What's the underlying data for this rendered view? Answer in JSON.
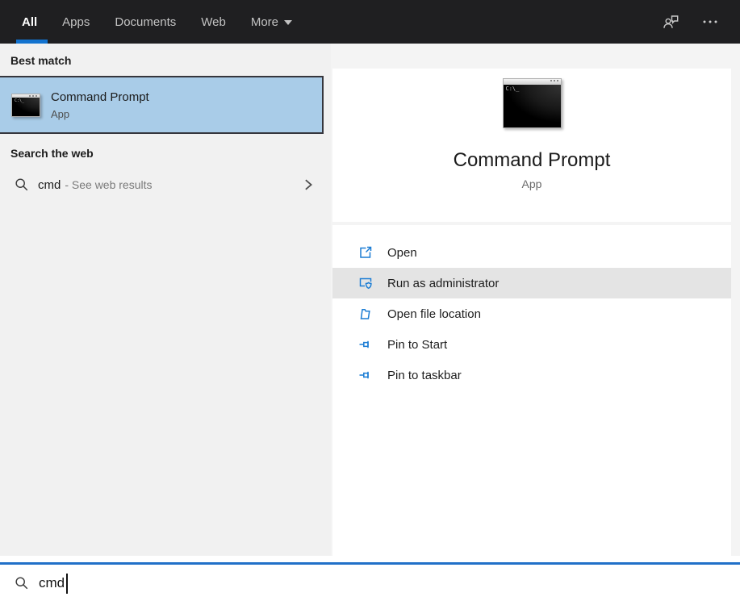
{
  "header": {
    "tabs": [
      {
        "label": "All",
        "active": true
      },
      {
        "label": "Apps",
        "active": false
      },
      {
        "label": "Documents",
        "active": false
      },
      {
        "label": "Web",
        "active": false
      },
      {
        "label": "More",
        "active": false,
        "has_dropdown": true
      }
    ]
  },
  "left_panel": {
    "best_match_header": "Best match",
    "best_match": {
      "title": "Command Prompt",
      "subtitle": "App"
    },
    "search_web_header": "Search the web",
    "web_result": {
      "query": "cmd",
      "suffix": "- See web results"
    }
  },
  "right_panel": {
    "preview": {
      "title": "Command Prompt",
      "subtitle": "App",
      "icon_prompt": "C:\\_"
    },
    "actions": [
      {
        "label": "Open",
        "icon": "launch-icon",
        "highlighted": false
      },
      {
        "label": "Run as administrator",
        "icon": "admin-shield-icon",
        "highlighted": true
      },
      {
        "label": "Open file location",
        "icon": "folder-icon",
        "highlighted": false
      },
      {
        "label": "Pin to Start",
        "icon": "pin-icon",
        "highlighted": false
      },
      {
        "label": "Pin to taskbar",
        "icon": "pin-icon",
        "highlighted": false
      }
    ]
  },
  "search_bar": {
    "value": "cmd"
  },
  "colors": {
    "topbar_bg": "#1f1f21",
    "accent_blue": "#1373cf",
    "selection_blue": "#a9cce8",
    "selection_border": "#36363d",
    "highlight_gray": "#e4e4e4",
    "action_icon_blue": "#1a7cd4",
    "search_border_blue": "#2170c8"
  }
}
